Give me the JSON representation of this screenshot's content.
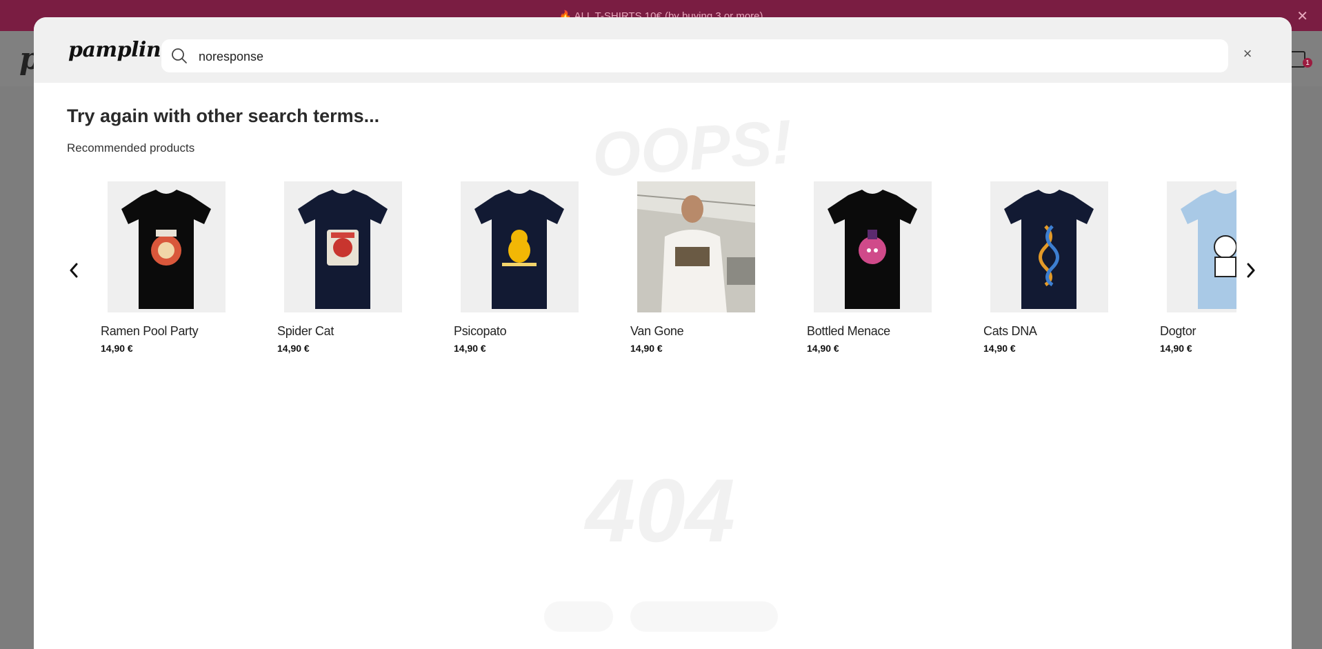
{
  "promo": {
    "text": "🔥 ALL T-SHIRTS 10€ (by buying 3 or more)",
    "close_icon": "close-icon"
  },
  "site": {
    "logo": "pampling",
    "cart_count": "1"
  },
  "modal": {
    "logo": "pampling",
    "search": {
      "value": "noresponse",
      "placeholder": "Search"
    },
    "close_label": "×",
    "heading": "Try again with other search terms...",
    "subheading": "Recommended products"
  },
  "products": [
    {
      "name": "Ramen Pool Party",
      "price": "14,90 €",
      "shirt_color": "#0b0b0b",
      "art": "ramen"
    },
    {
      "name": "Spider Cat",
      "price": "14,90 €",
      "shirt_color": "#121a33",
      "art": "spider"
    },
    {
      "name": "Psicopato",
      "price": "14,90 €",
      "shirt_color": "#121a33",
      "art": "duck"
    },
    {
      "name": "Van Gone",
      "price": "14,90 €",
      "shirt_color": "#f1ede9",
      "art": "photo"
    },
    {
      "name": "Bottled Menace",
      "price": "14,90 €",
      "shirt_color": "#0b0b0b",
      "art": "bottle"
    },
    {
      "name": "Cats DNA",
      "price": "14,90 €",
      "shirt_color": "#121a33",
      "art": "dna"
    },
    {
      "name": "Dogtor",
      "price": "14,90 €",
      "shirt_color": "#a9c9e6",
      "art": "dog"
    }
  ],
  "colors": {
    "promo_bg": "#7a1d42",
    "accent": "#9b1b3f"
  }
}
